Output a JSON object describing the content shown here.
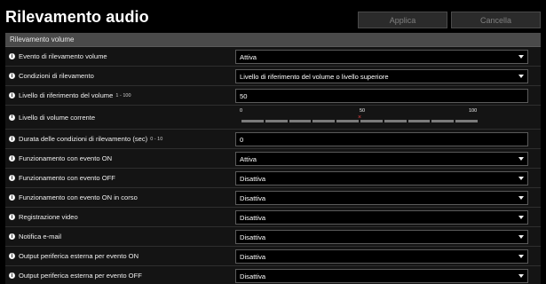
{
  "header": {
    "title": "Rilevamento audio",
    "apply_label": "Applica",
    "cancel_label": "Cancella"
  },
  "section": {
    "title": "Rilevamento volume"
  },
  "rows": [
    {
      "label": "Evento di rilevamento volume",
      "range": "",
      "value": "Attiva",
      "type": "select"
    },
    {
      "label": "Condizioni di rilevamento",
      "range": "",
      "value": "Livello di riferimento del volume o livello superiore",
      "type": "select"
    },
    {
      "label": "Livello di riferimento del volume",
      "range": "1 - 100",
      "value": "50",
      "type": "input"
    },
    {
      "label": "Livello di volume corrente",
      "range": "",
      "type": "meter"
    },
    {
      "label": "Durata delle condizioni di rilevamento (sec)",
      "range": "0 - 10",
      "value": "0",
      "type": "input"
    },
    {
      "label": "Funzionamento con evento ON",
      "range": "",
      "value": "Attiva",
      "type": "select"
    },
    {
      "label": "Funzionamento con evento OFF",
      "range": "",
      "value": "Disattiva",
      "type": "select"
    },
    {
      "label": "Funzionamento con evento ON in corso",
      "range": "",
      "value": "Disattiva",
      "type": "select"
    },
    {
      "label": "Registrazione video",
      "range": "",
      "value": "Disattiva",
      "type": "select"
    },
    {
      "label": "Notifica e-mail",
      "range": "",
      "value": "Disattiva",
      "type": "select"
    },
    {
      "label": "Output periferica esterna per evento ON",
      "range": "",
      "value": "Disattiva",
      "type": "select"
    },
    {
      "label": "Output periferica esterna per evento OFF",
      "range": "",
      "value": "Disattiva",
      "type": "select"
    }
  ],
  "meter": {
    "min_label": "0",
    "mid_label": "50",
    "max_label": "100",
    "reference_level": 50,
    "marker_glyph": "×",
    "segments": 10
  },
  "icons": {
    "info": "i"
  },
  "colors": {
    "background": "#000000",
    "section_header": "#4a4a4a",
    "marker": "#e04040"
  }
}
